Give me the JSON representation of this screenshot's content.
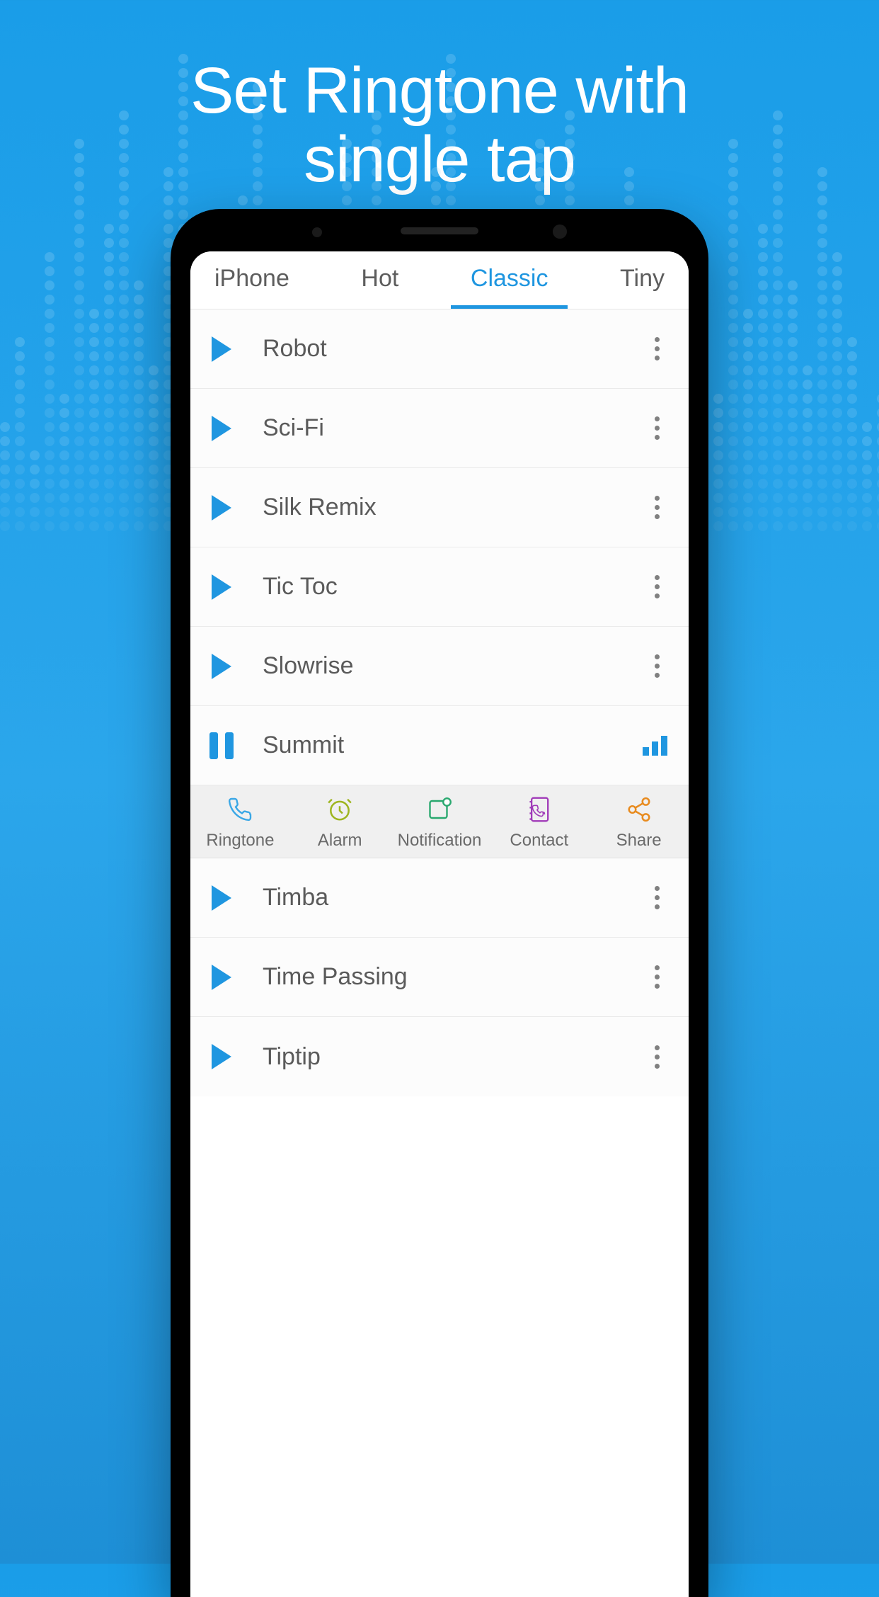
{
  "headline_line1": "Set Ringtone with",
  "headline_line2": "single tap",
  "tabs": [
    {
      "label": "iPhone",
      "active": false
    },
    {
      "label": "Hot",
      "active": false
    },
    {
      "label": "Classic",
      "active": true
    },
    {
      "label": "Tiny",
      "active": false
    }
  ],
  "tracks": [
    {
      "name": "Robot",
      "state": "play"
    },
    {
      "name": "Sci-Fi",
      "state": "play"
    },
    {
      "name": "Silk Remix",
      "state": "play"
    },
    {
      "name": "Tic Toc",
      "state": "play"
    },
    {
      "name": "Slowrise",
      "state": "play"
    },
    {
      "name": "Summit",
      "state": "pause"
    },
    {
      "name": "Timba",
      "state": "play"
    },
    {
      "name": "Time Passing",
      "state": "play"
    },
    {
      "name": "Tiptip",
      "state": "play"
    }
  ],
  "actions": [
    {
      "label": "Ringtone",
      "icon": "phone-icon",
      "color": "#3aa7e6"
    },
    {
      "label": "Alarm",
      "icon": "alarm-icon",
      "color": "#9eb51f"
    },
    {
      "label": "Notification",
      "icon": "notification-icon",
      "color": "#2aa86f"
    },
    {
      "label": "Contact",
      "icon": "contact-icon",
      "color": "#a03ab8"
    },
    {
      "label": "Share",
      "icon": "share-icon",
      "color": "#e88b1f"
    }
  ],
  "colors": {
    "accent": "#1f96e0",
    "text": "#5a5a5a",
    "tabInactive": "#5d5d5d"
  }
}
